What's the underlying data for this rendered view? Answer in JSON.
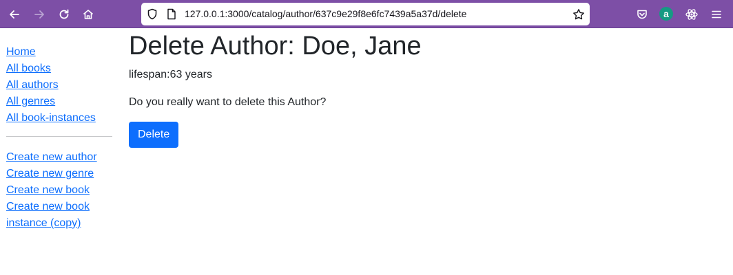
{
  "browser": {
    "url": "127.0.0.1:3000/catalog/author/637c9e29f8e6fc7439a5a37d/delete",
    "extension_badge_letter": "a",
    "icons": [
      "back-icon",
      "forward-icon",
      "reload-icon",
      "home-icon",
      "shield-icon",
      "page-icon",
      "star-icon",
      "pocket-icon",
      "react-icon",
      "menu-icon"
    ],
    "colors": {
      "toolbar": "#7d4fa6",
      "badge": "#159a83"
    }
  },
  "sidebar": {
    "nav": [
      "Home",
      "All books",
      "All authors",
      "All genres",
      "All book-instances"
    ],
    "create": [
      "Create new author",
      "Create new genre",
      "Create new book",
      "Create new book",
      "instance (copy)"
    ]
  },
  "main": {
    "title": "Delete Author: Doe, Jane",
    "lifespan": "lifespan:63 years",
    "confirm_text": "Do you really want to delete this Author?",
    "delete_label": "Delete",
    "button_color": "#0d6efd"
  }
}
